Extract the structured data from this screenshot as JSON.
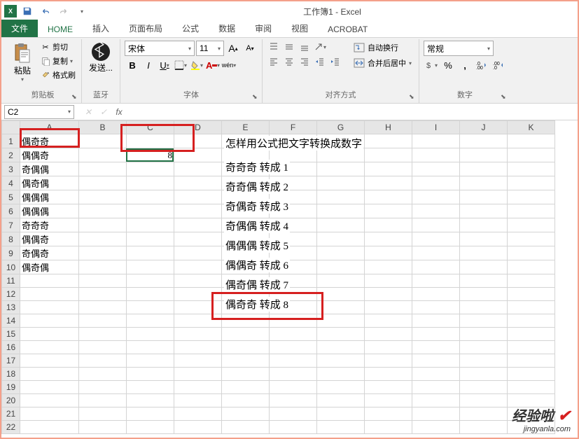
{
  "app": {
    "title": "工作簿1 - Excel"
  },
  "qat": {
    "icon_label": "X"
  },
  "tabs": {
    "file": "文件",
    "home": "HOME",
    "insert": "插入",
    "page_layout": "页面布局",
    "formulas": "公式",
    "data": "数据",
    "review": "审阅",
    "view": "视图",
    "acrobat": "ACROBAT"
  },
  "ribbon": {
    "clipboard": {
      "label": "剪贴板",
      "paste": "粘贴",
      "cut": "剪切",
      "copy": "复制",
      "format_painter": "格式刷"
    },
    "bluetooth": {
      "label": "蓝牙",
      "send": "发送..."
    },
    "font": {
      "label": "字体",
      "name": "宋体",
      "size": "11",
      "grow": "A",
      "shrink": "A",
      "bold": "B",
      "italic": "I",
      "underline": "U",
      "phonetic": "wén"
    },
    "alignment": {
      "label": "对齐方式",
      "wrap": "自动换行",
      "merge": "合并后居中"
    },
    "number": {
      "label": "数字",
      "format": "常规",
      "percent": "%",
      "comma": ",",
      "inc": ".0",
      "dec": ".00"
    }
  },
  "formula_bar": {
    "cell_ref": "C2",
    "formula": ""
  },
  "columns": [
    "A",
    "B",
    "C",
    "D",
    "E",
    "F",
    "G",
    "H",
    "I",
    "J",
    "K"
  ],
  "rows": [
    {
      "n": "1",
      "A": "偶奇奇",
      "C": ""
    },
    {
      "n": "2",
      "A": "偶偶奇",
      "C": "8"
    },
    {
      "n": "3",
      "A": "奇偶偶",
      "C": ""
    },
    {
      "n": "4",
      "A": "偶奇偶",
      "C": ""
    },
    {
      "n": "5",
      "A": "偶偶偶",
      "C": ""
    },
    {
      "n": "6",
      "A": "偶偶偶",
      "C": ""
    },
    {
      "n": "7",
      "A": "奇奇奇",
      "C": ""
    },
    {
      "n": "8",
      "A": "偶偶奇",
      "C": ""
    },
    {
      "n": "9",
      "A": "奇偶奇",
      "C": ""
    },
    {
      "n": "10",
      "A": "偶奇偶",
      "C": ""
    },
    {
      "n": "11",
      "A": "",
      "C": ""
    },
    {
      "n": "12",
      "A": "",
      "C": ""
    },
    {
      "n": "13",
      "A": "",
      "C": ""
    },
    {
      "n": "14",
      "A": "",
      "C": ""
    },
    {
      "n": "15",
      "A": "",
      "C": ""
    },
    {
      "n": "16",
      "A": "",
      "C": ""
    },
    {
      "n": "17",
      "A": "",
      "C": ""
    },
    {
      "n": "18",
      "A": "",
      "C": ""
    },
    {
      "n": "19",
      "A": "",
      "C": ""
    },
    {
      "n": "20",
      "A": "",
      "C": ""
    },
    {
      "n": "21",
      "A": "",
      "C": ""
    },
    {
      "n": "22",
      "A": "",
      "C": ""
    }
  ],
  "overflow": {
    "title": "怎样用公式把文字转换成数字",
    "lines": [
      "奇奇奇 转成 1",
      "奇奇偶 转成 2",
      "奇偶奇 转成 3",
      "奇偶偶 转成 4",
      "偶偶偶 转成 5",
      "偶偶奇 转成 6",
      "偶奇偶 转成 7",
      "偶奇奇 转成 8"
    ]
  },
  "watermark": {
    "main": "经验啦",
    "sub": "jingyanla.com"
  }
}
